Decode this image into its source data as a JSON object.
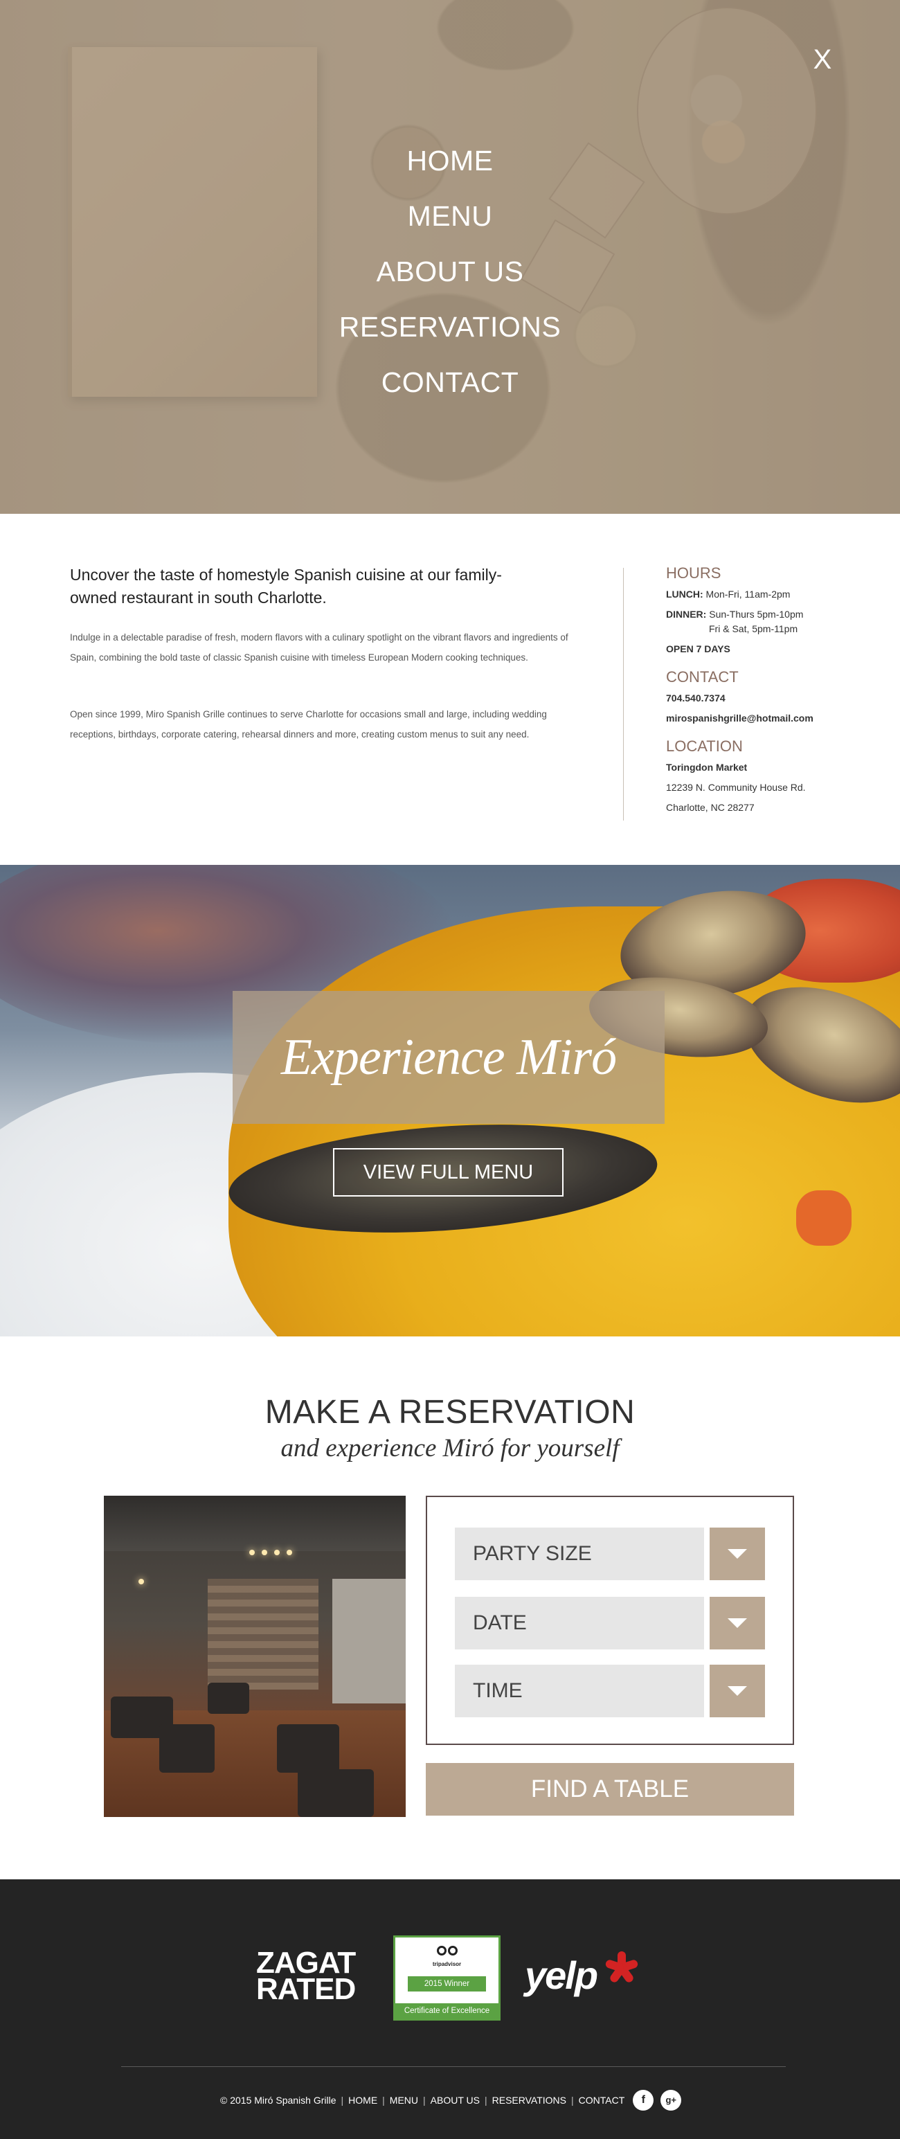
{
  "nav": {
    "close_label": "X",
    "items": [
      {
        "label": "HOME"
      },
      {
        "label": "MENU"
      },
      {
        "label": "ABOUT US"
      },
      {
        "label": "RESERVATIONS"
      },
      {
        "label": "CONTACT"
      }
    ]
  },
  "intro": {
    "heading": "Uncover the taste of homestyle Spanish cuisine at our family-owned restaurant in south Charlotte.",
    "paragraph_1": "Indulge in a delectable paradise of fresh, modern flavors with a culinary spotlight on the vibrant flavors and ingredients of Spain, combining the bold taste of classic Spanish cuisine with timeless European Modern cooking techniques.",
    "paragraph_2": "Open since 1999, Miro Spanish Grille continues to serve Charlotte for occasions small and large, including wedding receptions, birthdays, corporate catering, rehearsal dinners and more, creating custom menus to suit any need."
  },
  "info": {
    "hours_title": "HOURS",
    "lunch_label": "LUNCH:",
    "lunch_value": " Mon-Fri, 11am-2pm",
    "dinner_label": "DINNER:",
    "dinner_value_1": " Sun-Thurs 5pm-10pm",
    "dinner_value_2": "Fri & Sat,  5pm-11pm",
    "open_days": "OPEN 7 DAYS",
    "contact_title": "CONTACT",
    "phone": "704.540.7374",
    "email": "mirospanishgrille@hotmail.com",
    "location_title": "LOCATION",
    "location_name": "Toringdon Market",
    "address_1": "12239 N. Community House Rd.",
    "address_2": "Charlotte, NC 28277"
  },
  "banner": {
    "title": "Experience Miró",
    "button_label": "VIEW FULL MENU"
  },
  "reservation": {
    "title": "MAKE A RESERVATION",
    "subtitle": "and experience Miró for yourself",
    "party_size_placeholder": "PARTY SIZE",
    "date_placeholder": "DATE",
    "time_placeholder": "TIME",
    "submit_label": "FIND A TABLE"
  },
  "footer": {
    "zagat_line_1": "ZAGAT",
    "zagat_line_2": "RATED",
    "trip_brand": "tripadvisor",
    "trip_year": "2015 Winner",
    "trip_cert": "Certificate of Excellence",
    "yelp": "yelp",
    "copyright": "© 2015 Miró Spanish Grille",
    "links": [
      "HOME",
      "MENU",
      "ABOUT US",
      "RESERVATIONS",
      "CONTACT"
    ],
    "social": {
      "facebook": "f",
      "google_plus": "g+"
    }
  },
  "colors": {
    "accent_brown": "#8a6e62",
    "taupe": "#bca994",
    "footer_bg": "#242424",
    "trip_green": "#5ba243",
    "yelp_red": "#d32323"
  }
}
